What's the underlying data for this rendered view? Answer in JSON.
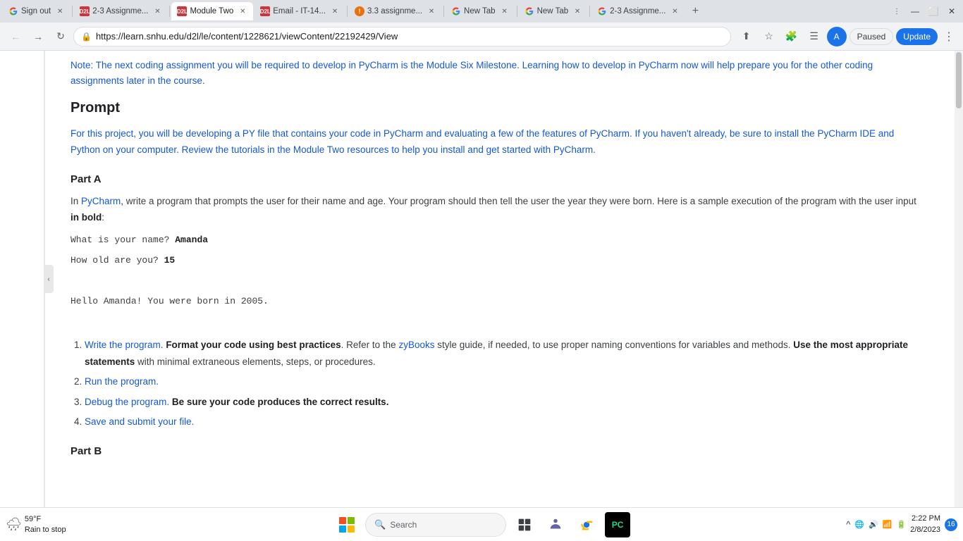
{
  "browser": {
    "tabs": [
      {
        "id": "signout",
        "title": "Sign out",
        "favicon_type": "google",
        "favicon_text": "G",
        "active": false
      },
      {
        "id": "d2l-assignment1",
        "title": "2-3 Assignme...",
        "favicon_type": "d2l",
        "favicon_text": "D2L",
        "active": false
      },
      {
        "id": "d2l-module2",
        "title": "Module Two",
        "favicon_type": "d2l",
        "favicon_text": "D2L",
        "active": true
      },
      {
        "id": "d2l-email",
        "title": "Email - IT-14...",
        "favicon_type": "d2l",
        "favicon_text": "D2L",
        "active": false
      },
      {
        "id": "d2l-assignment2",
        "title": "3.3 assignme...",
        "favicon_type": "notif",
        "favicon_text": "!",
        "active": false
      },
      {
        "id": "newtab1",
        "title": "New Tab",
        "favicon_type": "snhu",
        "favicon_text": "S",
        "active": false
      },
      {
        "id": "newtab2",
        "title": "New Tab",
        "favicon_type": "snhu",
        "favicon_text": "S",
        "active": false
      },
      {
        "id": "google-assign",
        "title": "2-3 Assignme...",
        "favicon_type": "google",
        "favicon_text": "G",
        "active": false
      }
    ],
    "url": "https://learn.snhu.edu/d2l/le/content/1228621/viewContent/22192429/View",
    "paused_label": "Paused",
    "update_label": "Update"
  },
  "content": {
    "note_text": "Note: The next coding assignment you will be required to develop in PyCharm is the Module Six Milestone. Learning how to develop in PyCharm now will help prepare you for the other coding assignments later in the course.",
    "prompt_heading": "Prompt",
    "prompt_intro": "For this project, you will be developing a PY file that contains your code in PyCharm and evaluating a few of the features of PyCharm. If you haven't already, be sure to install the PyCharm IDE and Python on your computer. Review the tutorials in the Module Two resources to help you install and get started with PyCharm.",
    "part_a_heading": "Part A",
    "part_a_text": "In PyCharm, write a program that prompts the user for their name and age. Your program should then tell the user the year they were born. Here is a sample execution of the program with the user input in bold:",
    "code_line1": "What is your name?",
    "code_line1_bold": "Amanda",
    "code_line2": "How old are you?",
    "code_line2_bold": "15",
    "code_line3": "Hello Amanda! You were born in 2005.",
    "list_items": [
      {
        "num": "1.",
        "text_before": "Write the program.",
        "bold_text": "Format your code using best practices",
        "text_after": ". Refer to the zyBooks style guide, if needed, to use proper naming conventions for variables and methods.",
        "bold_text2": "Use the most appropriate statements",
        "text_after2": " with minimal extraneous elements, steps, or procedures."
      },
      {
        "num": "2.",
        "text_before": "Run the program.",
        "bold_text": "",
        "text_after": "",
        "bold_text2": "",
        "text_after2": ""
      },
      {
        "num": "3.",
        "text_before": "Debug the program.",
        "bold_text": "Be sure your code produces the correct results.",
        "text_after": "",
        "bold_text2": "",
        "text_after2": ""
      },
      {
        "num": "4.",
        "text_before": "Save and submit your file.",
        "bold_text": "",
        "text_after": "",
        "bold_text2": "",
        "text_after2": ""
      }
    ],
    "part_b_heading": "Part B"
  },
  "taskbar": {
    "weather_temp": "59°F",
    "weather_desc": "Rain to stop",
    "search_placeholder": "Search",
    "time": "2:22 PM",
    "date": "2/8/2023"
  }
}
